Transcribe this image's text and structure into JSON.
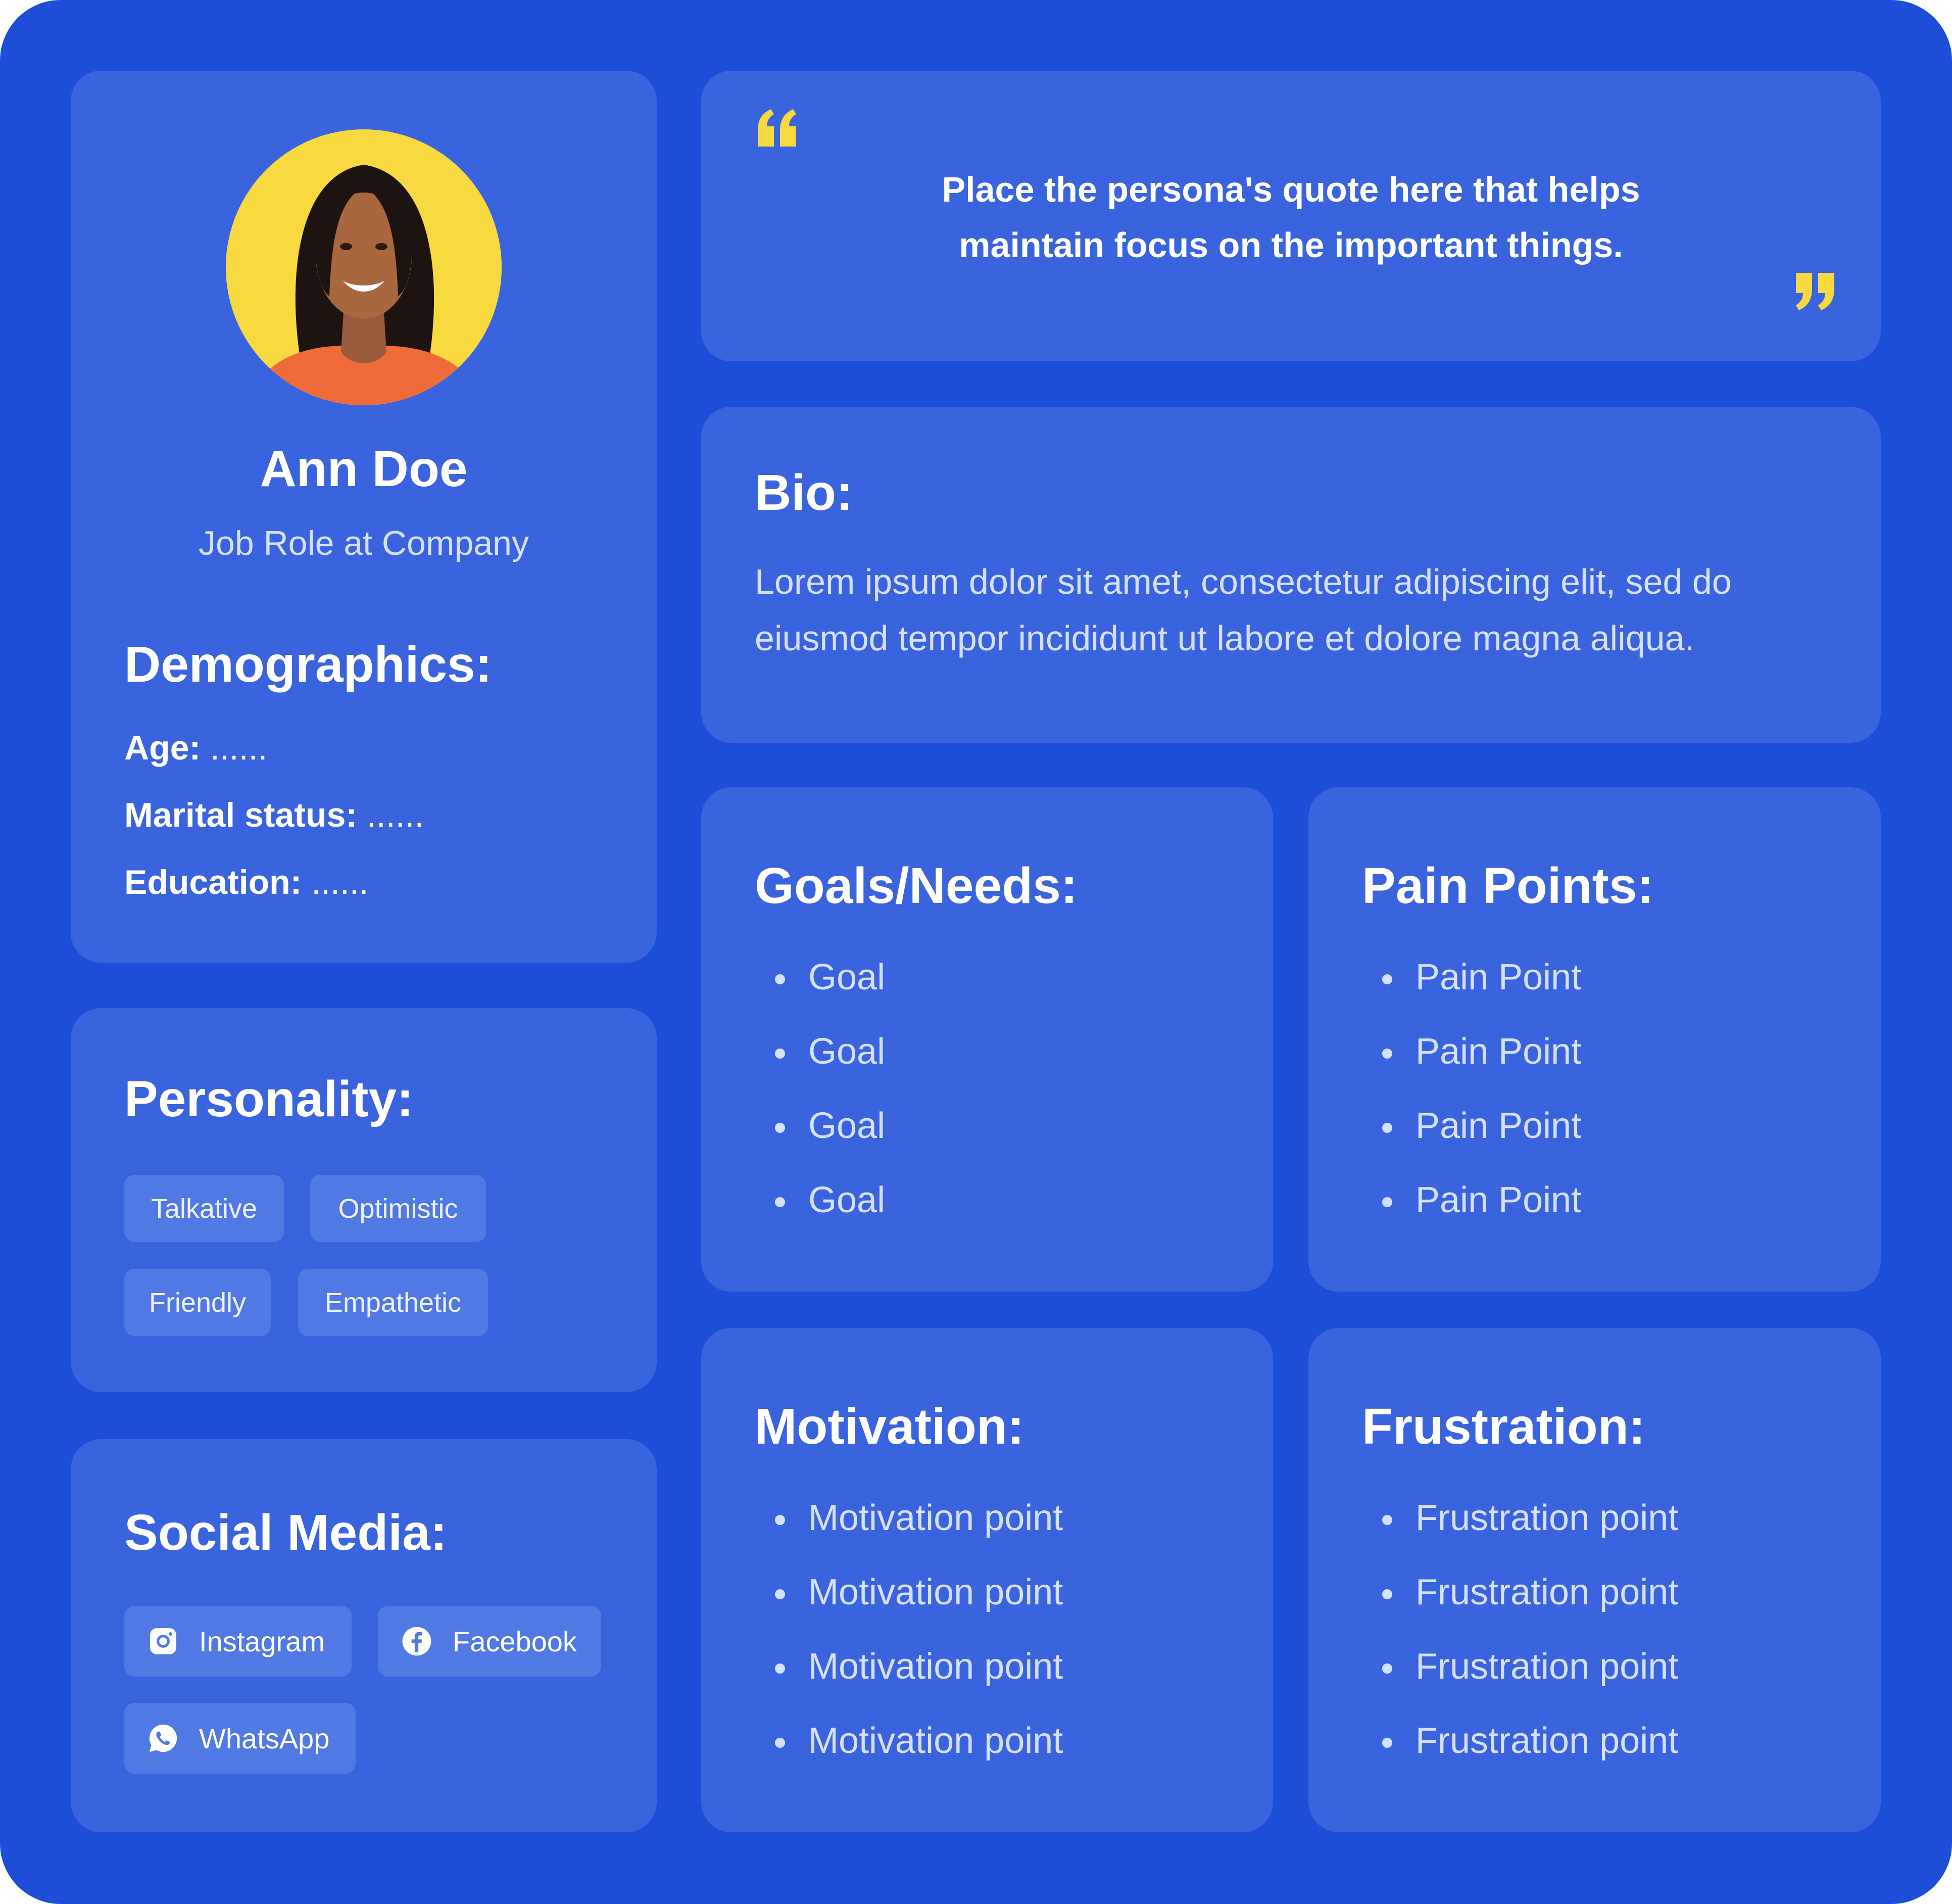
{
  "profile": {
    "name": "Ann Doe",
    "role": "Job Role at Company",
    "demographics_title": "Demographics:",
    "demographics": [
      {
        "key": "Age:",
        "value": "......"
      },
      {
        "key": "Marital status:",
        "value": "......"
      },
      {
        "key": "Education:",
        "value": "......"
      }
    ]
  },
  "personality": {
    "title": "Personality:",
    "traits": [
      "Talkative",
      "Optimistic",
      "Friendly",
      "Empathetic"
    ]
  },
  "social": {
    "title": "Social Media:",
    "items": [
      {
        "label": "Instagram",
        "icon": "instagram-icon"
      },
      {
        "label": "Facebook",
        "icon": "facebook-icon"
      },
      {
        "label": "WhatsApp",
        "icon": "whatsapp-icon"
      }
    ]
  },
  "quote": {
    "line1": "Place the persona's quote here that helps",
    "line2": "maintain focus on the important things."
  },
  "bio": {
    "title": "Bio:",
    "line1": "Lorem ipsum dolor sit amet, consectetur adipiscing elit, sed do",
    "line2": "eiusmod tempor incididunt ut labore et dolore magna aliqua."
  },
  "goals": {
    "title": "Goals/Needs:",
    "items": [
      "Goal",
      "Goal",
      "Goal",
      "Goal"
    ]
  },
  "pains": {
    "title": "Pain Points:",
    "items": [
      "Pain Point",
      "Pain Point",
      "Pain Point",
      "Pain Point"
    ]
  },
  "motivation": {
    "title": "Motivation:",
    "items": [
      "Motivation point",
      "Motivation point",
      "Motivation point",
      "Motivation point"
    ]
  },
  "frustration": {
    "title": "Frustration:",
    "items": [
      "Frustration point",
      "Frustration point",
      "Frustration point",
      "Frustration point"
    ]
  },
  "colors": {
    "background": "#1e4dd8",
    "card": "#3a64dd",
    "chip": "#5079e4",
    "accent": "#f8d940",
    "text": "#ffffff",
    "muted_text": "#d6e0ff"
  }
}
